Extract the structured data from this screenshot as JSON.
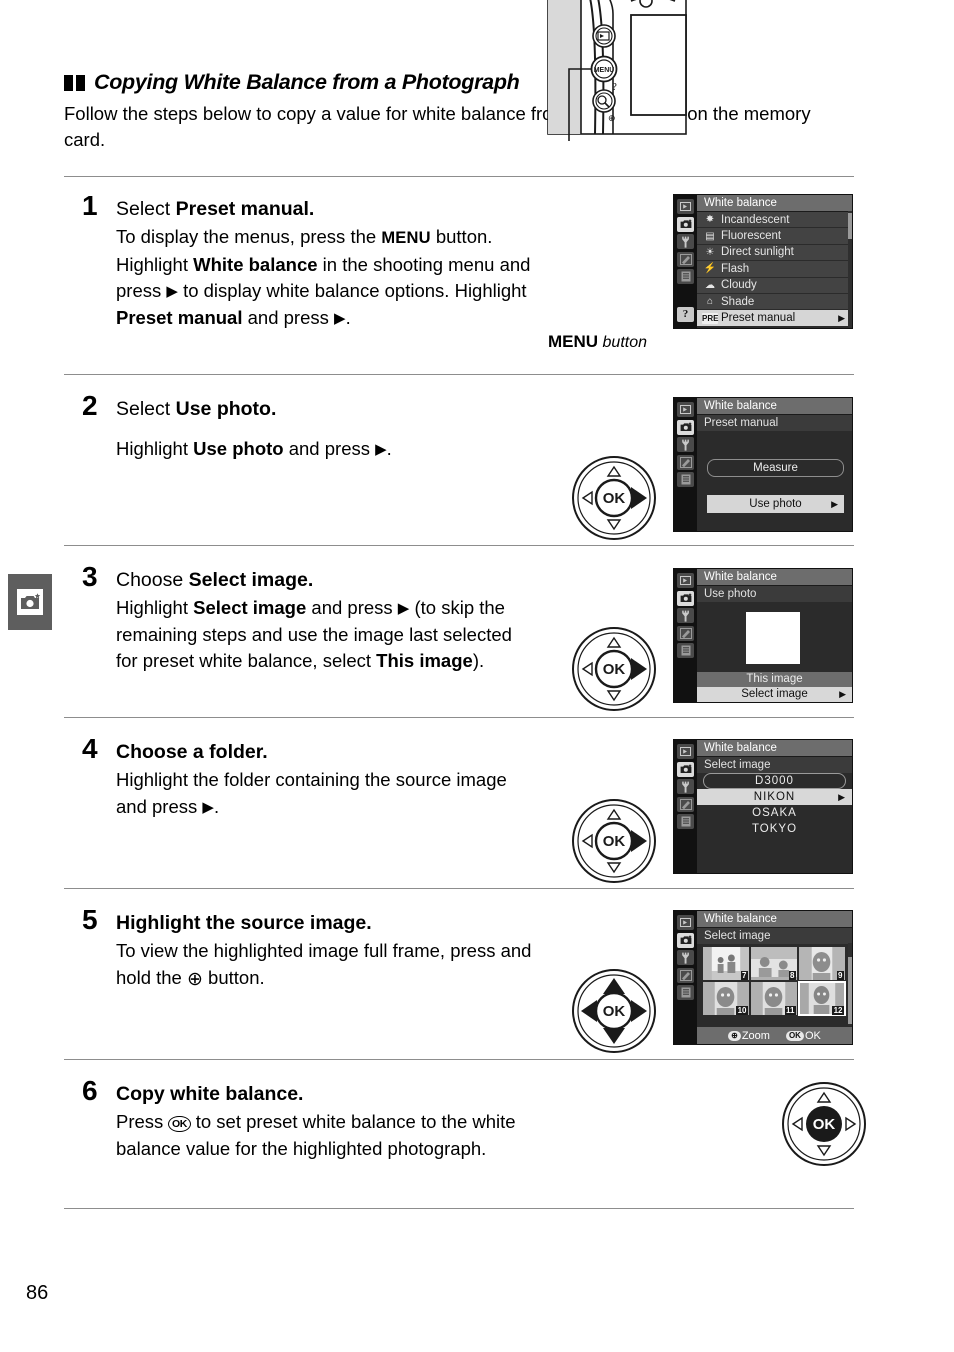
{
  "page": {
    "number": "86",
    "margin_tab_icon": "camera-icon"
  },
  "section": {
    "title": "Copying White Balance from a Photograph",
    "intro": "Follow the steps below to copy a value for white balance from a photograph on the memory card."
  },
  "steps": [
    {
      "num": "1",
      "title_plain": "Select ",
      "title_bold": "Preset manual.",
      "text_parts": {
        "p1": "To display the menus, press the ",
        "menu_btn": "MENU",
        "p2": " button. Highlight ",
        "b1": "White balance",
        "p3": " in the shooting menu and press ",
        "tri1": "▶",
        "p4": " to display white balance options.  Highlight ",
        "b2": "Preset manual",
        "p5": " and press ",
        "tri2": "▶",
        "p6": "."
      },
      "caption": {
        "button": "MENU",
        "word": "button"
      }
    },
    {
      "num": "2",
      "title_plain": "Select ",
      "title_bold": "Use photo.",
      "text_parts": {
        "p1": "Highlight ",
        "b1": "Use photo",
        "p2": " and press ",
        "tri1": "▶",
        "p3": "."
      }
    },
    {
      "num": "3",
      "title_plain": "Choose ",
      "title_bold": "Select image.",
      "text_parts": {
        "p1": "Highlight ",
        "b1": "Select image",
        "p2": " and press ",
        "tri1": "▶",
        "p3": " (to skip the remaining steps and use the image last selected for preset white balance, select ",
        "b2": "This image",
        "p4": ")."
      }
    },
    {
      "num": "4",
      "title_plain": "Choose a folder.",
      "title_bold": "",
      "text_parts": {
        "p1": "Highlight the folder containing the source image and press ",
        "tri1": "▶",
        "p2": "."
      }
    },
    {
      "num": "5",
      "title_plain": "Highlight the source image.",
      "title_bold": "",
      "text_parts": {
        "p1": "To view the highlighted image full frame, press and hold the ",
        "zoom": "⊕",
        "p2": " button."
      }
    },
    {
      "num": "6",
      "title_plain": "Copy white balance.",
      "title_bold": "",
      "text_parts": {
        "p1": "Press ",
        "ok": "OK",
        "p2": " to set preset white balance to the white balance value for the highlighted photograph."
      }
    }
  ],
  "screens": {
    "step1": {
      "title": "White balance",
      "sidebar_icons": [
        "playback-icon",
        "shooting-menu-icon",
        "setup-icon",
        "retouch-icon",
        "recent-settings-icon",
        "help-icon"
      ],
      "active_sidebar": "shooting-menu-icon",
      "items": [
        {
          "icon": "incandescent-icon",
          "label": "Incandescent",
          "selected": false
        },
        {
          "icon": "fluorescent-icon",
          "label": "Fluorescent",
          "selected": false
        },
        {
          "icon": "direct-sunlight-icon",
          "label": "Direct sunlight",
          "selected": false
        },
        {
          "icon": "flash-icon",
          "label": "Flash",
          "selected": false
        },
        {
          "icon": "cloudy-icon",
          "label": "Cloudy",
          "selected": false
        },
        {
          "icon": "shade-icon",
          "label": "Shade",
          "selected": false
        },
        {
          "icon": "PRE",
          "label": "Preset manual",
          "selected": true
        }
      ]
    },
    "step2": {
      "title": "White balance",
      "subtitle": "Preset manual",
      "options": [
        {
          "label": "Measure",
          "selected": false
        },
        {
          "label": "Use photo",
          "selected": true
        }
      ]
    },
    "step3": {
      "title": "White balance",
      "subtitle": "Use photo",
      "options": [
        {
          "label": "This image",
          "selected": false
        },
        {
          "label": "Select image",
          "selected": true
        }
      ]
    },
    "step4": {
      "title": "White balance",
      "subtitle": "Select image",
      "folders": [
        {
          "label": "D3000",
          "selected": false
        },
        {
          "label": "NIKON",
          "selected": true
        },
        {
          "label": "OSAKA",
          "selected": false
        },
        {
          "label": "TOKYO",
          "selected": false
        }
      ]
    },
    "step5": {
      "title": "White balance",
      "subtitle": "Select image",
      "thumbnails": [
        {
          "num": "7",
          "selected": false
        },
        {
          "num": "8",
          "selected": false
        },
        {
          "num": "9",
          "selected": false
        },
        {
          "num": "10",
          "selected": false
        },
        {
          "num": "11",
          "selected": false
        },
        {
          "num": "12",
          "selected": true
        }
      ],
      "footer": {
        "zoom_key": "⊕",
        "zoom_label": "Zoom",
        "ok_key": "OK",
        "ok_label": "OK"
      }
    }
  },
  "colors": {
    "lcd_bg": "#2b2b2b",
    "lcd_title_bar": "#6d6d6d",
    "lcd_row": "#434343",
    "lcd_selected": "#d6d6d6",
    "rule": "#8d8d8d",
    "margin_tab": "#5e5e5e"
  }
}
